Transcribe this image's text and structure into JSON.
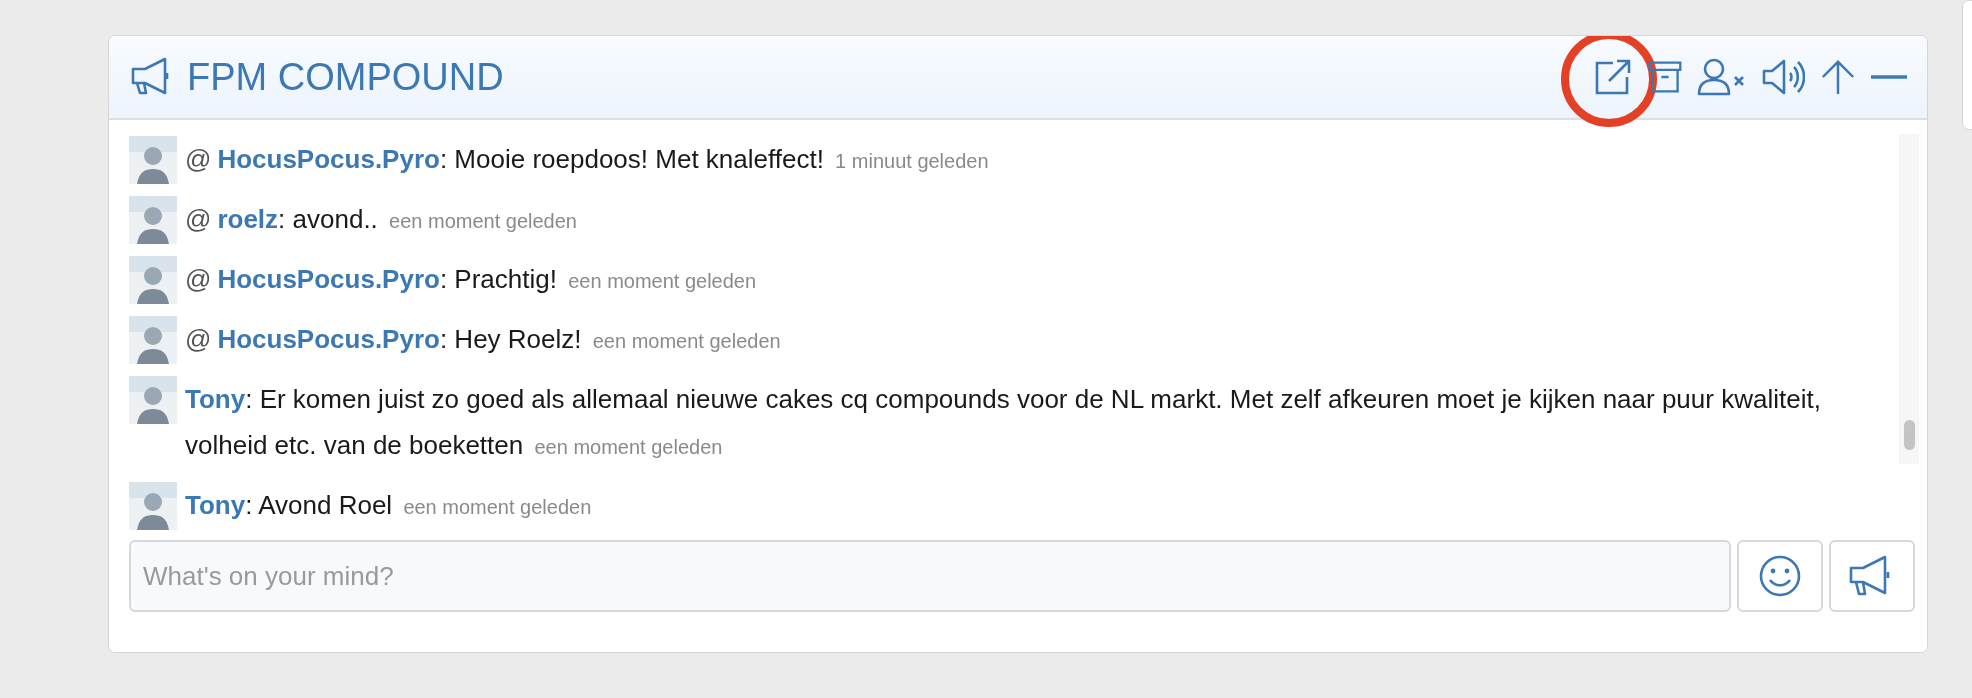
{
  "panel": {
    "title": "FPM COMPOUND",
    "actions": [
      {
        "kind": "popout",
        "highlighted": true
      },
      {
        "kind": "archive",
        "highlighted": false
      },
      {
        "kind": "block-user",
        "highlighted": false
      },
      {
        "kind": "sound",
        "highlighted": false
      },
      {
        "kind": "up",
        "highlighted": false
      },
      {
        "kind": "minimize",
        "highlighted": false
      }
    ],
    "messages": [
      {
        "prefix": "@",
        "author": "HocusPocus.Pyro",
        "text": ": Mooie roepdoos! Met knaleffect!",
        "time": "1 minuut geleden"
      },
      {
        "prefix": "@",
        "author": "roelz",
        "text": ": avond..",
        "time": "een moment geleden"
      },
      {
        "prefix": "@",
        "author": "HocusPocus.Pyro",
        "text": ": Prachtig!",
        "time": "een moment geleden"
      },
      {
        "prefix": "@",
        "author": "HocusPocus.Pyro",
        "text": ": Hey Roelz!",
        "time": "een moment geleden"
      },
      {
        "author": "Tony",
        "text": ": Er komen juist zo goed als allemaal nieuwe cakes cq compounds voor de NL markt. Met zelf afkeuren moet je kijken naar puur kwaliteit, volheid etc. van de boeketten",
        "time": "een moment geleden"
      },
      {
        "author": "Tony",
        "text": ": Avond Roel",
        "time": "een moment geleden"
      }
    ],
    "composer": {
      "placeholder": "What's on your mind?"
    }
  }
}
